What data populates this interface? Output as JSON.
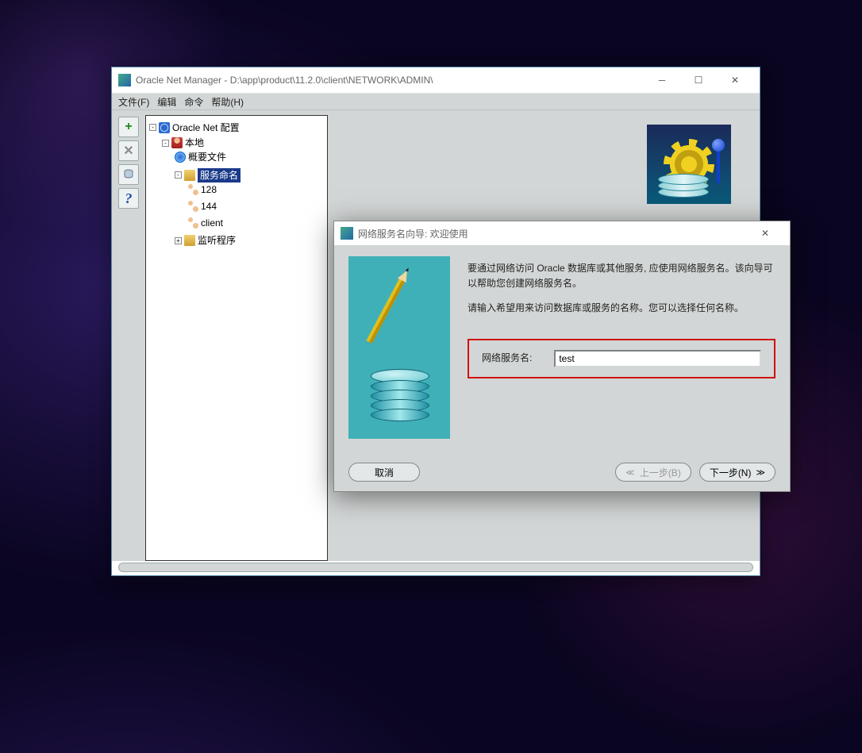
{
  "main": {
    "title": "Oracle Net Manager - D:\\app\\product\\11.2.0\\client\\NETWORK\\ADMIN\\",
    "menu": {
      "file": "文件(F)",
      "edit": "编辑",
      "cmd": "命令",
      "help": "帮助(H)"
    },
    "tree": {
      "root": "Oracle Net 配置",
      "local": "本地",
      "profile": "概要文件",
      "svcnaming": "服务命名",
      "items": [
        "128",
        "144",
        "client"
      ],
      "listener": "监听程序"
    }
  },
  "wizard": {
    "title": "网络服务名向导: 欢迎使用",
    "p1": "要通过网络访问 Oracle 数据库或其他服务, 应使用网络服务名。该向导可以帮助您创建网络服务名。",
    "p2": "请输入希望用来访问数据库或服务的名称。您可以选择任何名称。",
    "label": "网络服务名:",
    "value": "test",
    "btn_cancel": "取消",
    "btn_prev": "上一步(B)",
    "btn_next": "下一步(N)"
  }
}
